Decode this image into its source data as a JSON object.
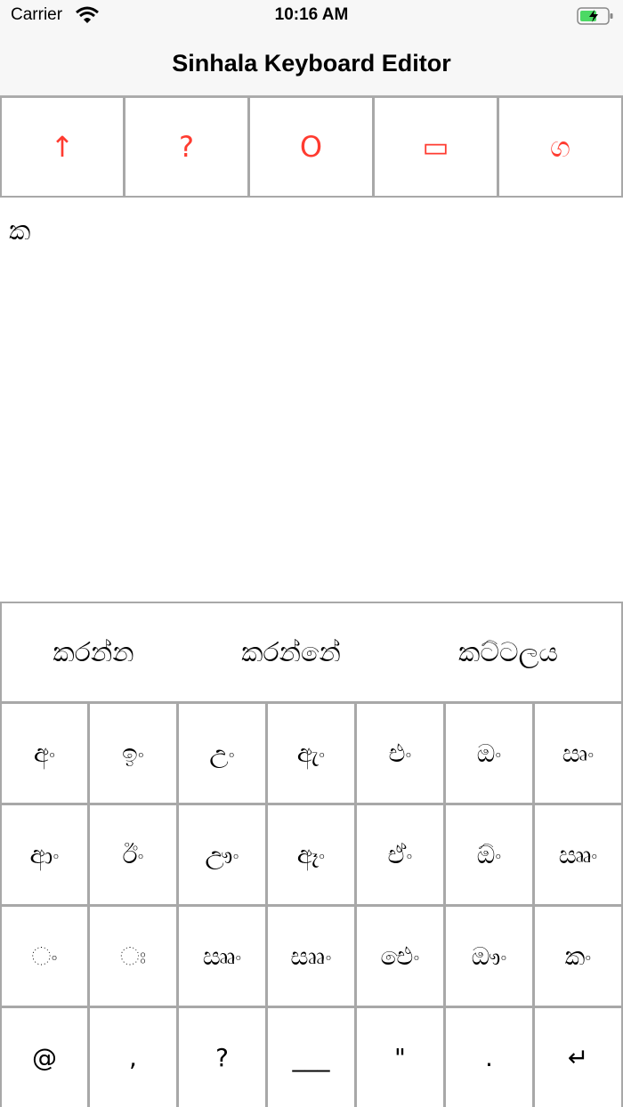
{
  "status": {
    "carrier": "Carrier",
    "time": "10:16 AM"
  },
  "nav": {
    "title": "Sinhala Keyboard Editor"
  },
  "toolbar": {
    "buttons": [
      {
        "label": "↑",
        "icon": "arrow-up-icon"
      },
      {
        "label": "?",
        "icon": "question-icon"
      },
      {
        "label": "O",
        "icon": "circle-icon"
      },
      {
        "label": "▭",
        "icon": "rectangle-icon"
      },
      {
        "label": "ග",
        "icon": "sinhala-letter-icon"
      }
    ]
  },
  "editor": {
    "text": "ක"
  },
  "keyboard": {
    "suggestions": [
      "කරන්න",
      "කරන්නේ",
      "කට්ටලය"
    ],
    "rows": [
      [
        "අං",
        "ඉං",
        "උං",
        "ඇං",
        "එං",
        "ඔං",
        "ඍං"
      ],
      [
        "ආං",
        "ඊං",
        "ඌං",
        "ඈං",
        "ඒං",
        "ඕං",
        "ඎං"
      ],
      [
        "ං",
        "ඃ",
        "ඎං",
        "සෲං",
        "ඓං",
        "ඖං",
        "කං"
      ],
      [
        "@",
        ",",
        "?",
        "___",
        "\"",
        ".",
        "↵"
      ]
    ]
  },
  "colors": {
    "accent": "#ff3b30",
    "grid": "#a8a8a8",
    "bar": "#f7f7f7"
  }
}
